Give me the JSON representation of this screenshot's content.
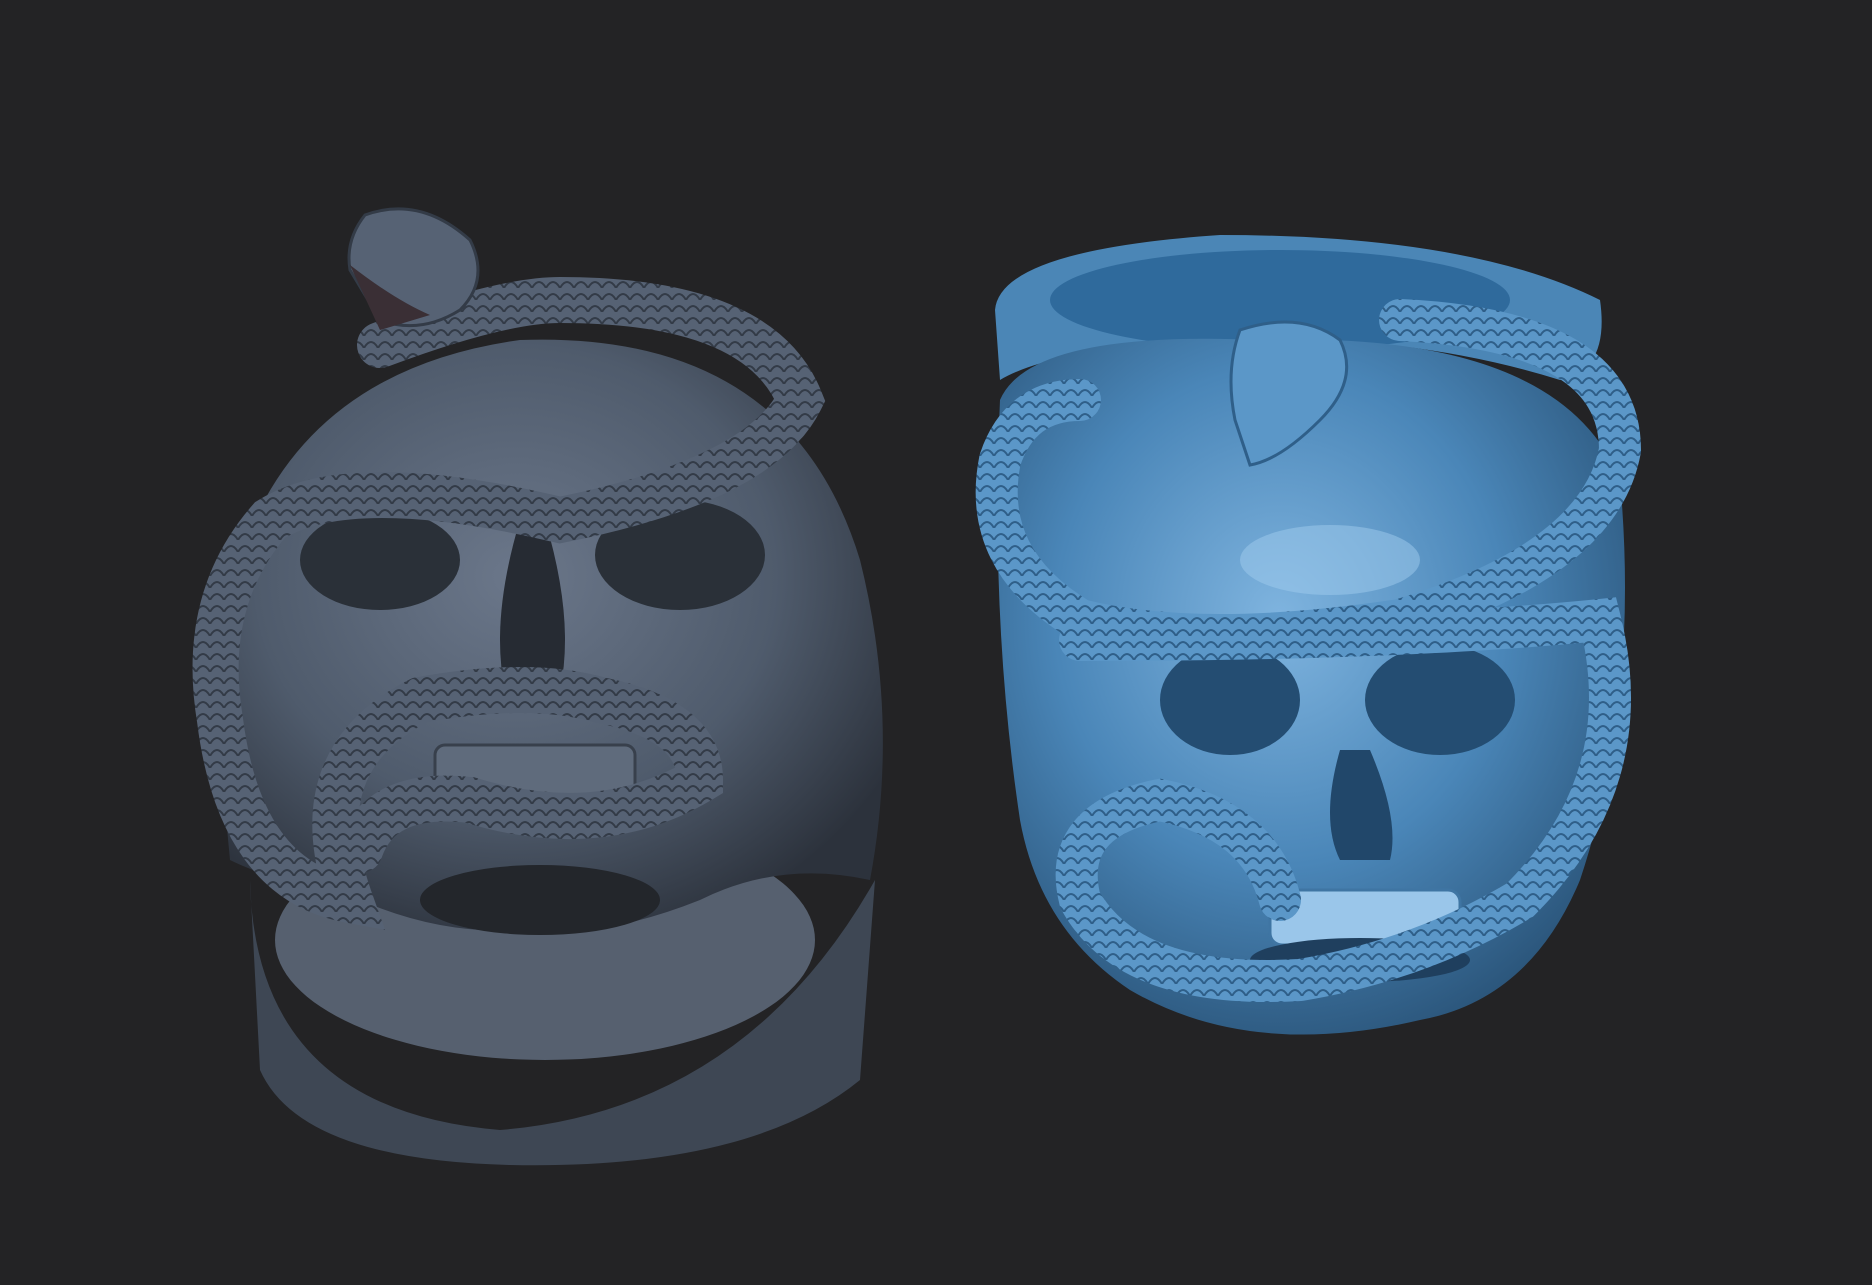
{
  "scene": {
    "background": "#232325",
    "models": [
      {
        "name": "skull-snake-ring-left",
        "view": "front-top",
        "material": "matte-slate",
        "color": "#4f5b6c",
        "highlight": "#7a879a",
        "shadow": "#2c323c"
      },
      {
        "name": "skull-snake-ring-right",
        "view": "three-quarter",
        "material": "glossy-blue",
        "color": "#4a86b8",
        "highlight": "#8ec0e6",
        "shadow": "#2a5479"
      }
    ]
  }
}
